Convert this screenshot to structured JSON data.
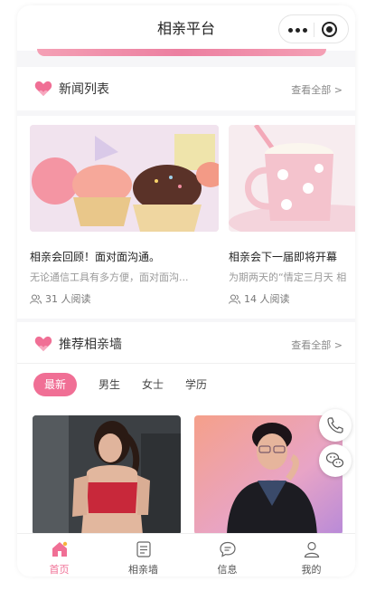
{
  "navbar": {
    "title": "相亲平台"
  },
  "news_section": {
    "title": "新闻列表",
    "more": "查看全部 >"
  },
  "news": [
    {
      "title": "相亲会回顾！面对面沟通。",
      "summary": "无论通信工具有多方便，面对面沟...",
      "reads": "31 人阅读"
    },
    {
      "title": "相亲会下一届即将开幕",
      "summary": "为期两天的“情定三月天 相",
      "reads": "14 人阅读"
    }
  ],
  "wall_section": {
    "title": "推荐相亲墙",
    "more": "查看全部 >"
  },
  "filter_tabs": [
    "最新",
    "男生",
    "女士",
    "学历"
  ],
  "tabbar": [
    "首页",
    "相亲墙",
    "信息",
    "我的"
  ],
  "colors": {
    "accent": "#f06f95"
  },
  "icons": {
    "phone": "phone-icon",
    "wechat": "wechat-icon",
    "heart": "heart-icon"
  }
}
